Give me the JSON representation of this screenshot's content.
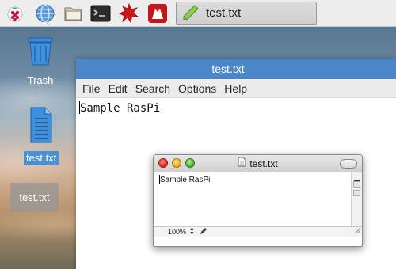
{
  "taskbar": {
    "launchers": [
      {
        "name": "raspberry-menu-icon"
      },
      {
        "name": "web-browser-icon"
      },
      {
        "name": "file-manager-icon"
      },
      {
        "name": "terminal-icon"
      },
      {
        "name": "math-kernel-icon"
      },
      {
        "name": "wolfram-icon"
      }
    ],
    "active_task": {
      "icon": "text-editor-icon",
      "label": "test.txt"
    }
  },
  "desktop": {
    "trash": {
      "label": "Trash",
      "icon": "trash-icon"
    },
    "file": {
      "label": "test.txt",
      "icon": "text-file-icon"
    },
    "ghost_label": "test.txt"
  },
  "main_window": {
    "title": "test.txt",
    "menu": [
      "File",
      "Edit",
      "Search",
      "Options",
      "Help"
    ],
    "content": "Sample RasPi"
  },
  "mac_window": {
    "title": "test.txt",
    "content": "Sample RasPi",
    "zoom": "100%"
  },
  "colors": {
    "title_bar": "#4b86c9",
    "selection": "#4a90d9"
  }
}
